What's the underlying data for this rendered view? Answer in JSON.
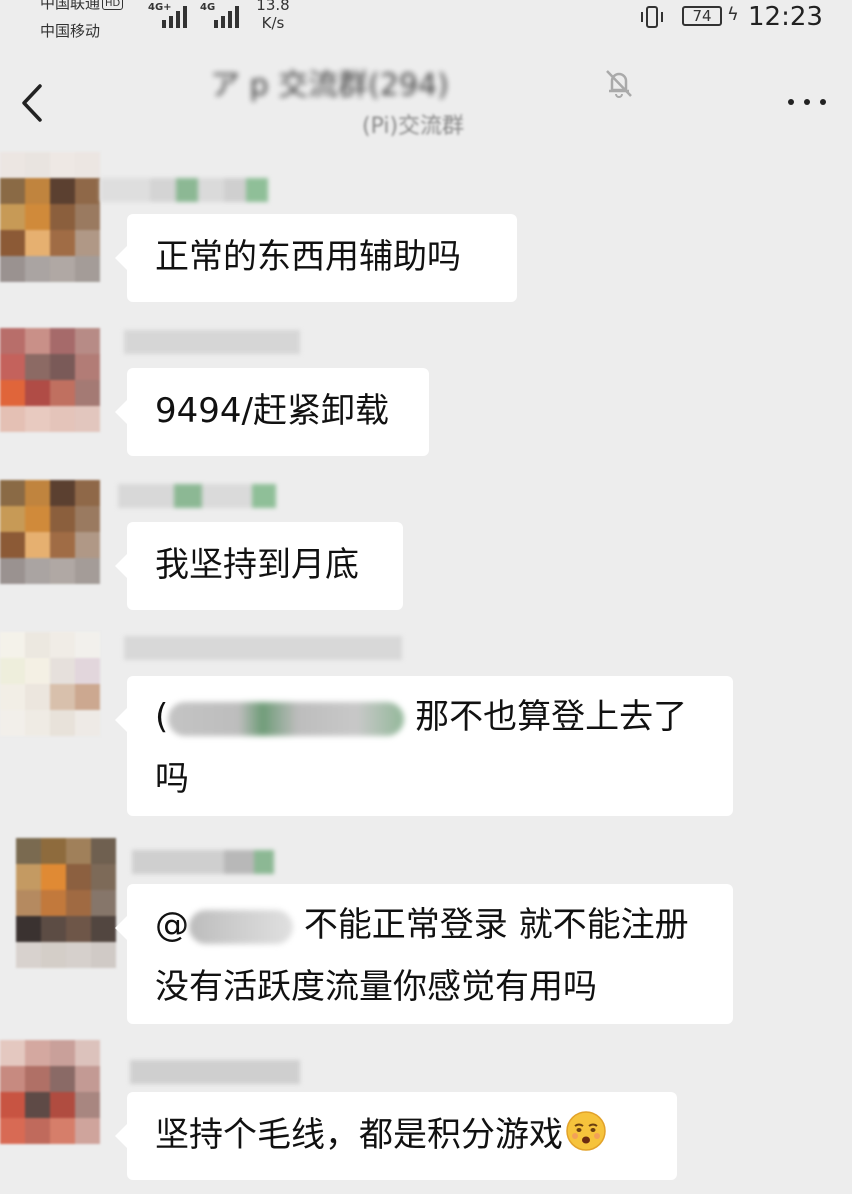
{
  "status_bar": {
    "carrier_1": "中国联通",
    "carrier_1_badge": "HD",
    "carrier_2": "中国移动",
    "signal_1_label": "4G+",
    "signal_2_label": "4G",
    "speed_value": "13.8",
    "speed_unit": "K/s",
    "battery": "74",
    "time": "12:23"
  },
  "header": {
    "title": "ア p 交流群(294)",
    "subtitle": "(Pi)交流群",
    "back_icon": "chevron-left-icon",
    "mute_icon": "bell-off-icon",
    "more_icon": "more-dots-icon"
  },
  "messages": [
    {
      "text": "正常的东西用辅助吗"
    },
    {
      "text": "9494/赶紧卸载"
    },
    {
      "text": "我坚持到月底"
    },
    {
      "prefix": "(",
      "text": "那不也算登上去了吗"
    },
    {
      "prefix": "@",
      "text_1": "不能正常登录 就不能注册",
      "text_2": "没有活跃度流量你感觉有用吗"
    },
    {
      "text": "坚持个毛线，都是积分游戏",
      "emoji": "hushed-face-emoji"
    }
  ],
  "colors": {
    "page_bg": "#ededed",
    "bubble_bg": "#ffffff",
    "text": "#111111",
    "subtle": "#888888"
  }
}
